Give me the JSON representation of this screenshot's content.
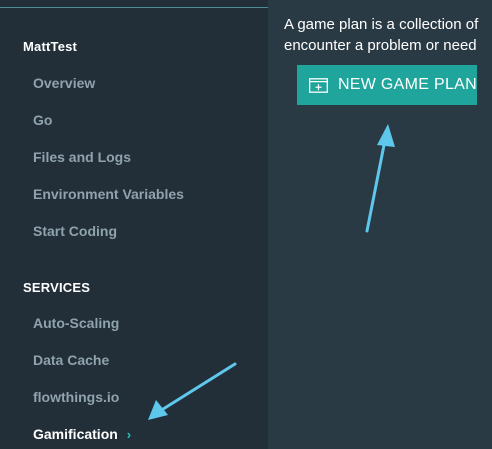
{
  "sidebar": {
    "project_heading": "MattTest",
    "project_items": [
      {
        "label": "Overview"
      },
      {
        "label": "Go"
      },
      {
        "label": "Files and Logs"
      },
      {
        "label": "Environment Variables"
      },
      {
        "label": "Start Coding"
      }
    ],
    "services_heading": "SERVICES",
    "service_items": [
      {
        "label": "Auto-Scaling"
      },
      {
        "label": "Data Cache"
      },
      {
        "label": "flowthings.io"
      },
      {
        "label": "Gamification",
        "active": true,
        "chevron": "›"
      }
    ]
  },
  "main": {
    "intro_line1": "A game plan is a collection of",
    "intro_line2": "encounter a problem or need",
    "new_game_plan_button": {
      "label": "NEW GAME PLAN",
      "icon": "plus-box-icon"
    }
  },
  "annotations": {
    "arrow_color": "#5ec7ec",
    "arrows": [
      "arrow-to-new-game-plan",
      "arrow-to-gamification"
    ]
  },
  "colors": {
    "sidebar_bg": "#232f38",
    "main_bg": "#2a3a45",
    "accent": "#1fa59b",
    "nav_text": "#8fa2ad"
  }
}
